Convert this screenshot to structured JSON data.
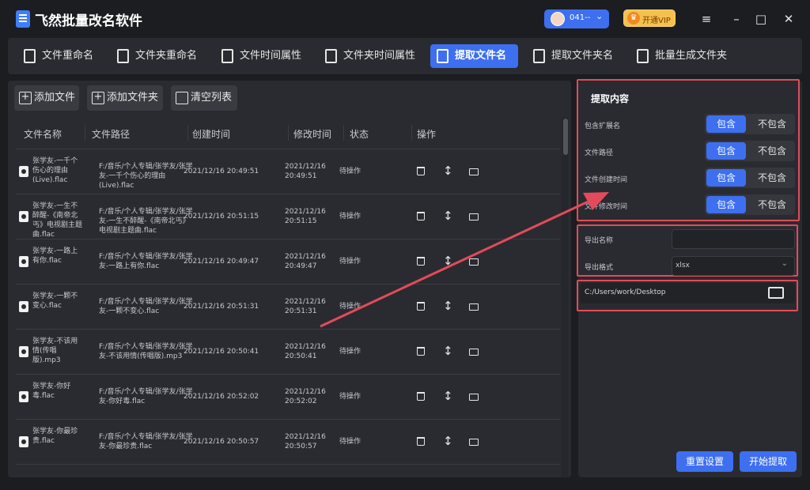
{
  "app": {
    "title": "飞然批量改名软件"
  },
  "user": {
    "name": "041--",
    "chevron": "⌄"
  },
  "vip": {
    "label": "开通VIP",
    "crown": "♛"
  },
  "window_controls": {
    "menu": "≡",
    "minimize": "–",
    "maximize": "□",
    "close": "✕"
  },
  "tabs": [
    {
      "label": "文件重命名"
    },
    {
      "label": "文件夹重命名"
    },
    {
      "label": "文件时间属性"
    },
    {
      "label": "文件夹时间属性"
    },
    {
      "label": "提取文件名"
    },
    {
      "label": "提取文件夹名"
    },
    {
      "label": "批量生成文件夹"
    }
  ],
  "toolbar": {
    "add_file": "添加文件",
    "add_folder": "添加文件夹",
    "clear_list": "清空列表"
  },
  "table": {
    "headers": [
      "文件名称",
      "文件路径",
      "创建时间",
      "修改时间",
      "状态",
      "操作"
    ],
    "rows": [
      {
        "name": "张学友-一千个伤心的理由(Live).flac",
        "path": "F:/音乐/个人专辑/张学友/张学友-一千个伤心的理由(Live).flac",
        "ctime": "2021/12/16 20:49:51",
        "mtime": "2021/12/16 20:49:51",
        "status": "待操作"
      },
      {
        "name": "张学友-一生不醉醒-《南帝北丐》电视剧主题曲.flac",
        "path": "F:/音乐/个人专辑/张学友/张学友-一生不醉醒-《南帝北丐》电视剧主题曲.flac",
        "ctime": "2021/12/16 20:51:15",
        "mtime": "2021/12/16 20:51:15",
        "status": "待操作"
      },
      {
        "name": "张学友-一路上有你.flac",
        "path": "F:/音乐/个人专辑/张学友/张学友-一路上有你.flac",
        "ctime": "2021/12/16 20:49:47",
        "mtime": "2021/12/16 20:49:47",
        "status": "待操作"
      },
      {
        "name": "张学友-一颗不变心.flac",
        "path": "F:/音乐/个人专辑/张学友/张学友-一颗不变心.flac",
        "ctime": "2021/12/16 20:51:31",
        "mtime": "2021/12/16 20:51:31",
        "status": "待操作"
      },
      {
        "name": "张学友-不该用情(传唱版).mp3",
        "path": "F:/音乐/个人专辑/张学友/张学友-不该用情(传唱版).mp3",
        "ctime": "2021/12/16 20:50:41",
        "mtime": "2021/12/16 20:50:41",
        "status": "待操作"
      },
      {
        "name": "张学友-你好毒.flac",
        "path": "F:/音乐/个人专辑/张学友/张学友-你好毒.flac",
        "ctime": "2021/12/16 20:52:02",
        "mtime": "2021/12/16 20:52:02",
        "status": "待操作"
      },
      {
        "name": "张学友-你最珍贵.flac",
        "path": "F:/音乐/个人专辑/张学友/张学友-你最珍贵.flac",
        "ctime": "2021/12/16 20:50:57",
        "mtime": "2021/12/16 20:50:57",
        "status": "待操作"
      }
    ],
    "action_move_glyph": "↕"
  },
  "extract": {
    "title": "提取内容",
    "options": [
      {
        "label": "包含扩展名",
        "on": "包含",
        "off": "不包含"
      },
      {
        "label": "文件路径",
        "on": "包含",
        "off": "不包含"
      },
      {
        "label": "文件创建时间",
        "on": "包含",
        "off": "不包含"
      },
      {
        "label": "文件修改时间",
        "on": "包含",
        "off": "不包含"
      }
    ]
  },
  "export": {
    "name_label": "导出名称",
    "name_value": "",
    "format_label": "导出格式",
    "format_value": "xlsx",
    "chevron": "⌄"
  },
  "output_path": "C:/Users/work/Desktop",
  "buttons": {
    "reset": "重置设置",
    "start": "开始提取"
  },
  "colors": {
    "accent": "#3d6ff0",
    "highlight": "#e34b5b",
    "bg": "#1c1d21",
    "panel": "#2a2b30"
  }
}
